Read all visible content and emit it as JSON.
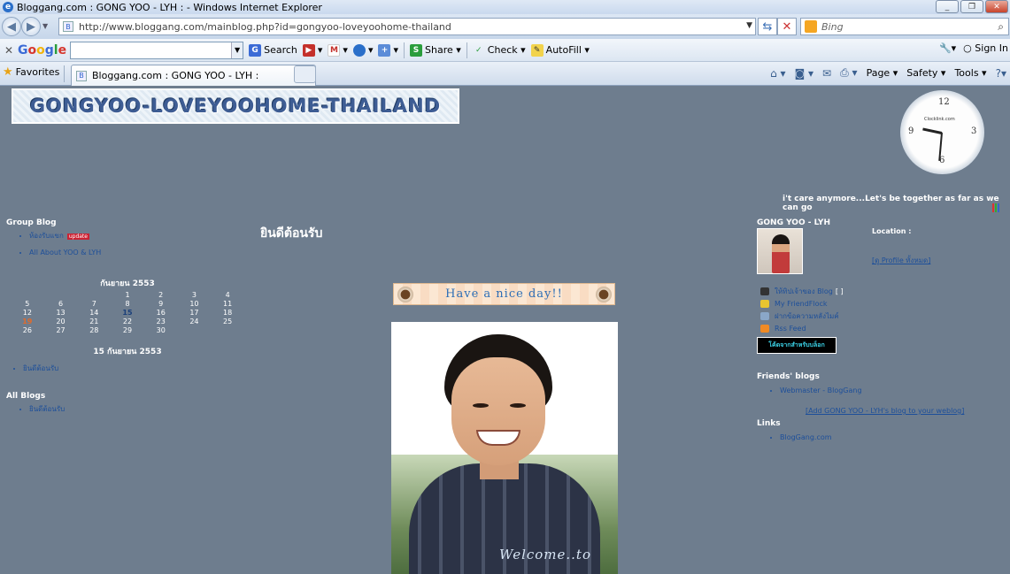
{
  "window": {
    "title": "Bloggang.com : GONG YOO - LYH : - Windows Internet Explorer"
  },
  "address": {
    "url": "http://www.bloggang.com/mainblog.php?id=gongyoo-loveyoohome-thailand",
    "search_placeholder": "Bing"
  },
  "google_toolbar": {
    "logo": [
      "G",
      "o",
      "o",
      "g",
      "l",
      "e"
    ],
    "search_label": "Search",
    "share_label": "Share",
    "check_label": "Check",
    "autofill_label": "AutoFill",
    "sign_in_label": "Sign In"
  },
  "tabs": {
    "favorites_label": "Favorites",
    "active_tab": "Bloggang.com : GONG YOO - LYH :",
    "page_label": "Page",
    "safety_label": "Safety",
    "tools_label": "Tools"
  },
  "page": {
    "banner": "GONGYOO-LOVEYOOHOME-THAILAND",
    "clock": {
      "brand": "Clocklink.com",
      "n12": "12",
      "n3": "3",
      "n6": "6",
      "n9": "9"
    },
    "marquee": "i't care anymore...Let's be together as far as we can go",
    "group_blog_title": "Group Blog",
    "group_blog_items": [
      "ห้องรับแขก",
      "All About YOO & LYH"
    ],
    "new_badge": "update",
    "calendar": {
      "title": "กันยายน 2553",
      "rows": [
        [
          "",
          "",
          "",
          "1",
          "2",
          "3",
          "4"
        ],
        [
          "5",
          "6",
          "7",
          "8",
          "9",
          "10",
          "11"
        ],
        [
          "12",
          "13",
          "14",
          "15",
          "16",
          "17",
          "18"
        ],
        [
          "19",
          "20",
          "21",
          "22",
          "23",
          "24",
          "25"
        ],
        [
          "26",
          "27",
          "28",
          "29",
          "30",
          "",
          ""
        ]
      ],
      "today": "15",
      "highlight": "19",
      "selected_date": "15 กันยายน 2553"
    },
    "date_entries": [
      "ยินดีต้อนรับ"
    ],
    "all_blogs_title": "All Blogs",
    "all_blogs_items": [
      "ยินดีต้อนรับ"
    ],
    "center_title": "ยินดีต้อนรับ",
    "nice_day_text": "Have a nice day!!",
    "welcome_text": "Welcome..to",
    "owner_name": "GONG YOO - LYH",
    "location_label": "Location :",
    "profile_link": "[ดู Profile ทั้งหมด]",
    "owner_links": [
      "ให้ทิปเจ้าของ Blog",
      "My FriendFlock",
      "ฝากข้อความหลังไมค์",
      "Rss Feed"
    ],
    "owner_link_bracket": "[ ]",
    "code_button": "โค้ดจากสำหรับบล็อก",
    "friends_title": "Friends' blogs",
    "friends_items": [
      "Webmaster - BlogGang"
    ],
    "add_blog_link": "[Add GONG YOO - LYH's blog to your weblog]",
    "links_title": "Links",
    "links_items": [
      "BlogGang.com"
    ]
  }
}
